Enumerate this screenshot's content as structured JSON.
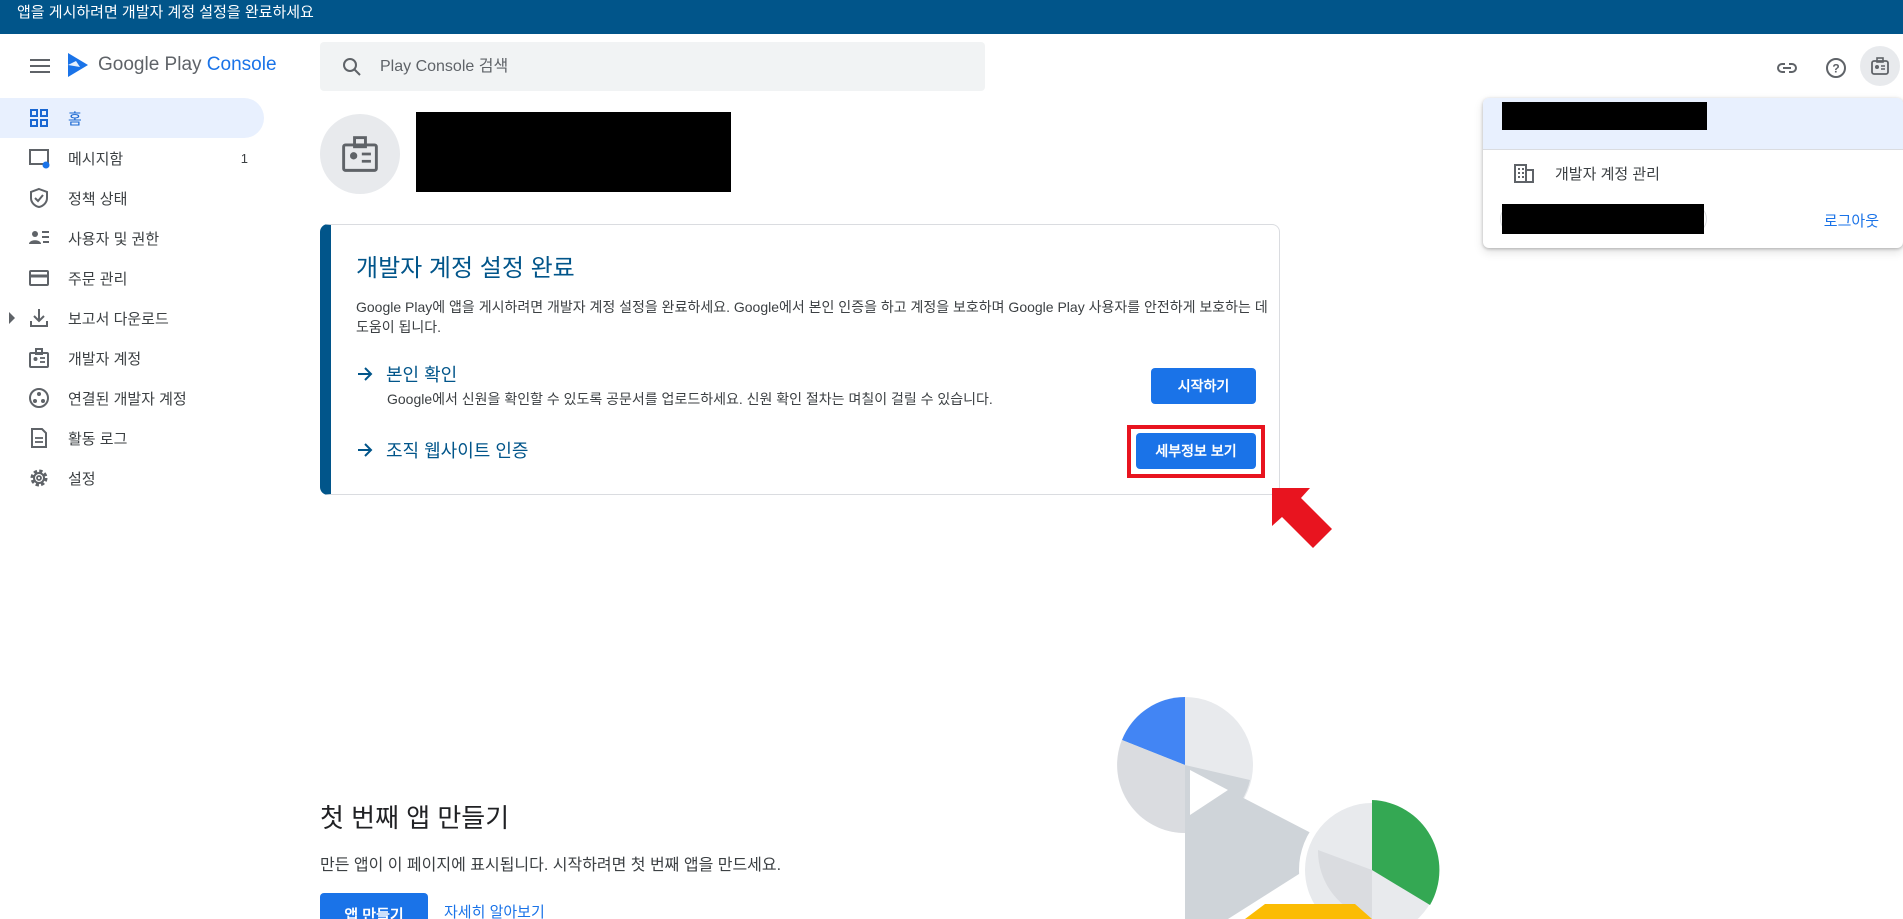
{
  "banner": {
    "text": "앱을 게시하려면 개발자 계정 설정을 완료하세요"
  },
  "header": {
    "logo_text_1": "Google Play ",
    "logo_text_2": "Console",
    "search_placeholder": "Play Console 검색"
  },
  "sidebar": {
    "items": [
      {
        "label": "홈",
        "icon": "dashboard-icon",
        "active": true
      },
      {
        "label": "메시지함",
        "icon": "inbox-icon",
        "count": "1"
      },
      {
        "label": "정책 상태",
        "icon": "shield-check-icon"
      },
      {
        "label": "사용자 및 권한",
        "icon": "people-list-icon"
      },
      {
        "label": "주문 관리",
        "icon": "credit-card-icon"
      },
      {
        "label": "보고서 다운로드",
        "icon": "download-icon",
        "expandable": true
      },
      {
        "label": "개발자 계정",
        "icon": "badge-icon"
      },
      {
        "label": "연결된 개발자 계정",
        "icon": "linked-accounts-icon"
      },
      {
        "label": "활동 로그",
        "icon": "document-icon"
      },
      {
        "label": "설정",
        "icon": "gear-icon"
      }
    ]
  },
  "setup_card": {
    "title": "개발자 계정 설정 완료",
    "description": "Google Play에 앱을 게시하려면 개발자 계정 설정을 완료하세요. Google에서 본인 인증을 하고 계정을 보호하며 Google Play 사용자를 안전하게 보호하는 데 도움이 됩니다.",
    "tasks": [
      {
        "label": "본인 확인",
        "sub": "Google에서 신원을 확인할 수 있도록 공문서를 업로드하세요. 신원 확인 절차는 며칠이 걸릴 수 있습니다.",
        "button": "시작하기"
      },
      {
        "label": "조직 웹사이트 인증",
        "button": "세부정보 보기"
      }
    ]
  },
  "account_popover": {
    "manage_label": "개발자 계정 관리",
    "logout_label": "로그아웃"
  },
  "empty_state": {
    "title": "첫 번째 앱 만들기",
    "description": "만든 앱이 이 페이지에 표시됩니다. 시작하려면 첫 번째 앱을 만드세요.",
    "create_button": "앱 만들기",
    "learn_more": "자세히 알아보기"
  },
  "colors": {
    "banner": "#01558a",
    "primary": "#1a73e8",
    "highlight": "#e8141f",
    "illustration_blue": "#4285f4",
    "illustration_green": "#34a853",
    "illustration_yellow": "#fbbc04"
  }
}
